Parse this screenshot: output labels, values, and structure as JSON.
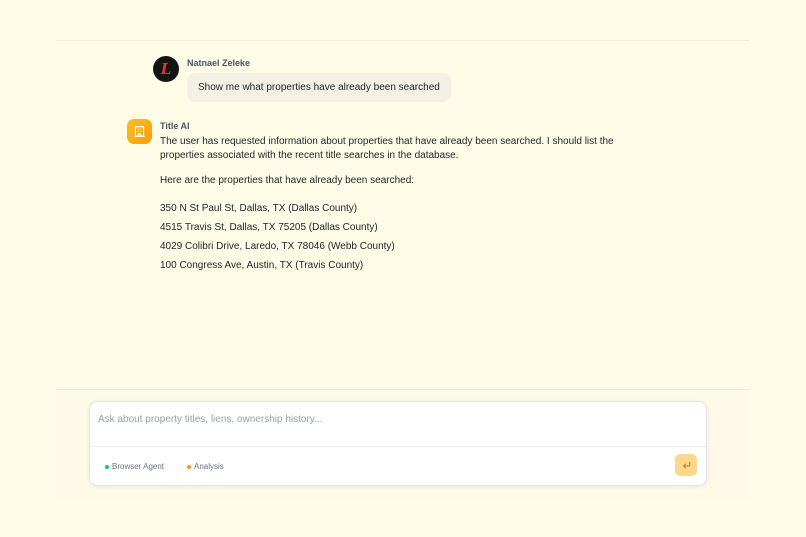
{
  "conversation": {
    "user_message": {
      "author": "Natnael Zeleke",
      "avatar_letter": "L",
      "text": "Show me what properties have already been searched"
    },
    "ai_message": {
      "author": "Title AI",
      "avatar_icon": "building-icon",
      "intro": "The user has requested information about properties that have already been searched. I should list the properties associated with the recent title searches in the database.",
      "list_heading": "Here are the properties that have already been searched:",
      "properties": [
        "350 N St Paul St, Dallas, TX (Dallas County)",
        "4515 Travis St, Dallas, TX 75205 (Dallas County)",
        "4029 Colibri Drive, Laredo, TX 78046 (Webb County)",
        "100 Congress Ave, Austin, TX (Travis County)"
      ]
    }
  },
  "composer": {
    "placeholder": "Ask about property titles, liens, ownership history...",
    "value": "",
    "modes": [
      {
        "label": "Browser Agent",
        "color": "#22c55e"
      },
      {
        "label": "Analysis",
        "color": "#f59e0b"
      }
    ],
    "send_icon": "return-arrow-icon"
  },
  "colors": {
    "background": "#fefbe6",
    "accent": "#f59e0b",
    "send_button": "#fcd98a",
    "user_bubble": "#f3f1e6"
  }
}
